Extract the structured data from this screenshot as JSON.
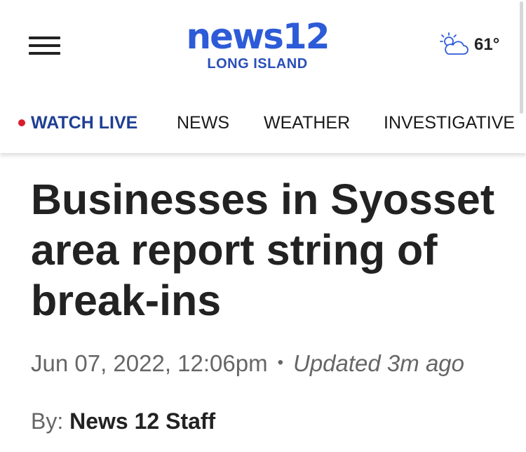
{
  "header": {
    "logo_main": "news12",
    "logo_sub": "LONG ISLAND",
    "weather_icon": "partly-cloudy-icon",
    "temperature": "61°"
  },
  "nav": {
    "live_label": "WATCH LIVE",
    "items": [
      "NEWS",
      "WEATHER",
      "INVESTIGATIVE"
    ],
    "live_dot_color": "#d81e2a",
    "accent_color": "#1f3f94"
  },
  "article": {
    "headline": "Businesses in Syosset area report string of break-ins",
    "date": "Jun 07, 2022, 12:06pm",
    "separator": "•",
    "updated": "Updated 3m ago",
    "byline_prefix": "By:",
    "author": "News 12 Staff"
  },
  "colors": {
    "brand_blue": "#2d5bd8",
    "text_dark": "#222222",
    "text_muted": "#666666"
  }
}
